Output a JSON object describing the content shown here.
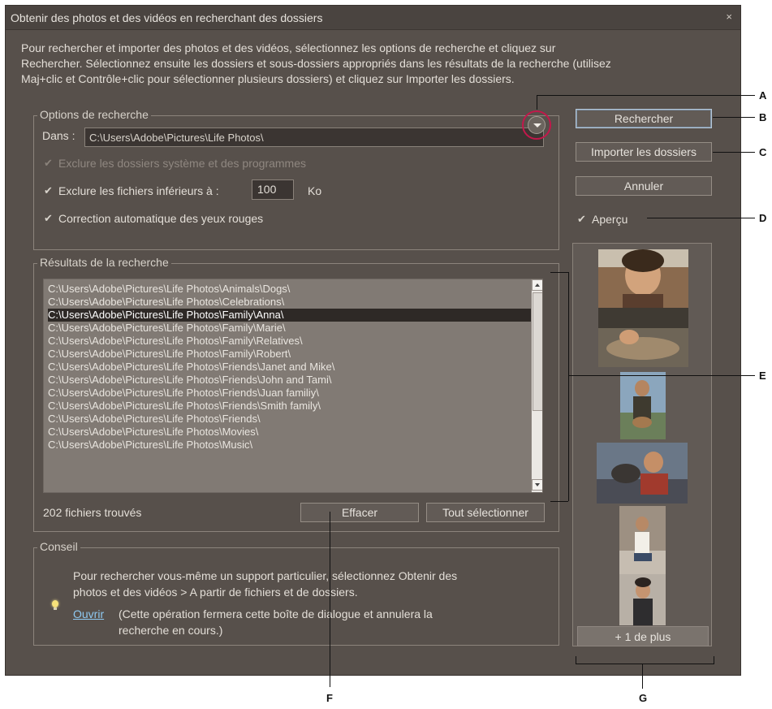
{
  "dialog": {
    "title": "Obtenir des photos et des vidéos en recherchant des dossiers",
    "close_glyph": "×",
    "intro_line1": "Pour rechercher et importer des photos et des vidéos, sélectionnez les options de recherche et cliquez sur",
    "intro_line2": "Rechercher. Sélectionnez ensuite les dossiers et sous-dossiers appropriés dans les résultats de la recherche (utilisez",
    "intro_line3": "Maj+clic et Contrôle+clic pour sélectionner plusieurs dossiers) et cliquez sur Importer les dossiers."
  },
  "options": {
    "legend": "Options de recherche",
    "dans_label": "Dans :",
    "dans_value": "C:\\Users\\Adobe\\Pictures\\Life Photos\\",
    "exclude_system_label": "Exclure les dossiers système et des programmes",
    "exclude_small_label": "Exclure les fichiers inférieurs à :",
    "exclude_small_value": "100",
    "exclude_small_unit": "Ko",
    "redeye_label": "Correction automatique des yeux rouges",
    "check_glyph": "✔"
  },
  "buttons": {
    "search": "Rechercher",
    "import": "Importer les dossiers",
    "cancel": "Annuler",
    "clear": "Effacer",
    "select_all": "Tout sélectionner"
  },
  "preview": {
    "label": "Aperçu",
    "more": "+ 1 de plus"
  },
  "results": {
    "legend": "Résultats de la recherche",
    "count_text": "202 fichiers trouvés",
    "selected_index": 2,
    "rows": [
      "C:\\Users\\Adobe\\Pictures\\Life Photos\\Animals\\Dogs\\",
      "C:\\Users\\Adobe\\Pictures\\Life Photos\\Celebrations\\",
      "C:\\Users\\Adobe\\Pictures\\Life Photos\\Family\\Anna\\",
      "C:\\Users\\Adobe\\Pictures\\Life Photos\\Family\\Marie\\",
      "C:\\Users\\Adobe\\Pictures\\Life Photos\\Family\\Relatives\\",
      "C:\\Users\\Adobe\\Pictures\\Life Photos\\Family\\Robert\\",
      "C:\\Users\\Adobe\\Pictures\\Life Photos\\Friends\\Janet and Mike\\",
      "C:\\Users\\Adobe\\Pictures\\Life Photos\\Friends\\John and Tami\\",
      "C:\\Users\\Adobe\\Pictures\\Life Photos\\Friends\\Juan familiy\\",
      "C:\\Users\\Adobe\\Pictures\\Life Photos\\Friends\\Smith family\\",
      "C:\\Users\\Adobe\\Pictures\\Life Photos\\Friends\\",
      "C:\\Users\\Adobe\\Pictures\\Life Photos\\Movies\\",
      "C:\\Users\\Adobe\\Pictures\\Life Photos\\Music\\"
    ]
  },
  "tip": {
    "legend": "Conseil",
    "line1": "Pour rechercher vous-même un support particulier, sélectionnez Obtenir des",
    "line2": "photos et des vidéos > A partir de fichiers et de dossiers.",
    "link": "Ouvrir",
    "line3": "(Cette opération fermera cette boîte de dialogue et annulera la",
    "line4": "recherche en cours.)"
  },
  "callouts": {
    "a": "A",
    "b": "B",
    "c": "C",
    "d": "D",
    "e": "E",
    "f": "F",
    "g": "G"
  },
  "icons": [
    "close-icon",
    "dropdown-arrow-icon",
    "checkbox-icon",
    "lightbulb-icon",
    "scroll-up-icon",
    "scroll-down-icon",
    "scroll-grip-icon"
  ],
  "colors": {
    "dialog_bg": "#57504b",
    "highlight_ring": "#c2184b",
    "link": "#8ec8f0"
  }
}
